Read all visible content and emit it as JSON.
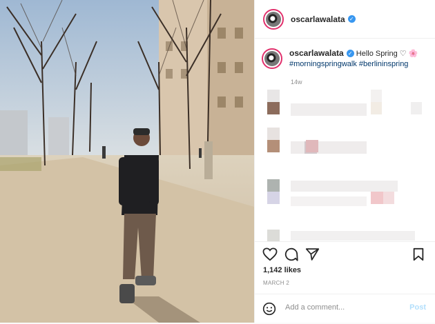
{
  "post": {
    "username": "oscarlawalata",
    "verified_mark": "✓",
    "caption_text": "Hello Spring ♡",
    "caption_flower": "🌸",
    "hashtags": "#morningspringwalk #berlininspring",
    "age": "14w",
    "likes": "1,142 likes",
    "date": "MARCH 2"
  },
  "comment": {
    "placeholder": "Add a comment...",
    "post_label": "Post"
  },
  "icons": {
    "like": "heart-icon",
    "comment": "comment-icon",
    "share": "send-icon",
    "save": "bookmark-icon",
    "emoji": "emoji-icon"
  },
  "colors": {
    "verified": "#3897f0",
    "hashtag": "#00376b",
    "post_button": "#b2dffc"
  }
}
